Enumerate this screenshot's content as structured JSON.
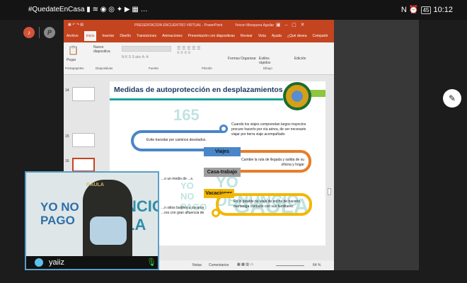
{
  "status_bar": {
    "hashtag": "#QuedateEnCasa",
    "icons": [
      "signal-icon",
      "wifi-icon",
      "opera-icon",
      "whatsapp-icon",
      "twitter-icon",
      "youtube-icon",
      "gallery-icon",
      "more-icon"
    ],
    "battery": "45",
    "time": "10:12"
  },
  "meeting_buttons": {
    "mic_label": "♪",
    "pen_label": "P"
  },
  "powerpoint": {
    "title": "PRESENTACION ENCUENTRO VIRTUAL - PowerPoint",
    "user": "Yeicon Mosquera Aguilar",
    "tabs": [
      "Archivo",
      "Inicio",
      "Insertar",
      "Diseño",
      "Transiciones",
      "Animaciones",
      "Presentación con diapositivas",
      "Revisar",
      "Vista",
      "Ayuda",
      "¿Qué desea",
      "Compartir"
    ],
    "ribbon": {
      "paste": "Pegar",
      "new_slide": "Nuevo diapositiva",
      "shapes": "Formas",
      "arrange": "Organizar",
      "styles": "Estilos rápidos",
      "edit": "Edición",
      "groups": [
        "Portapapeles",
        "Diapositivas",
        "Fuente",
        "Párrafo",
        "Dibujo"
      ]
    },
    "thumbnails": [
      "14",
      "15",
      "16"
    ],
    "slide": {
      "title": "Medidas de autoprotección en desplazamientos",
      "watermark": [
        "165",
        "YO NO PAGO",
        "YO DENUNCIO",
        "GAULA"
      ],
      "items": [
        {
          "label": "Viajes",
          "color": "#4a86c8",
          "left_text": "Evite transitar por caminos desolados.",
          "right_text": "Cuando los viajes comprendan largos trayectos procure hacerlo por vía aérea, de ser necesario viajar por tierra viaje acompañado."
        },
        {
          "label": "Casa-trabajo",
          "color": "#9e9e9e",
          "left_text": "...o un medio de ...s.",
          "right_text": "Cambie la ruta de llegada y salida de su oficina y hogar"
        },
        {
          "label": "Vacaciones",
          "color": "#f2b705",
          "left_text": "...n sitios baldíos u oscuros ...res con gran afluencia de",
          "right_text": "En lo posible no viaje de noche de hacerlo mantenga contacto con sus familiares."
        }
      ],
      "orange": "#e87d2c"
    },
    "status": {
      "notes": "Notas",
      "comments": "Comentarios",
      "zoom": "64 %"
    }
  },
  "video": {
    "participant": "yaiiz",
    "bg_text": [
      "YO NO",
      "PAGO",
      "NCIO",
      "LA"
    ],
    "cap_text": "GAULA"
  },
  "fab_icon": "pen-icon"
}
